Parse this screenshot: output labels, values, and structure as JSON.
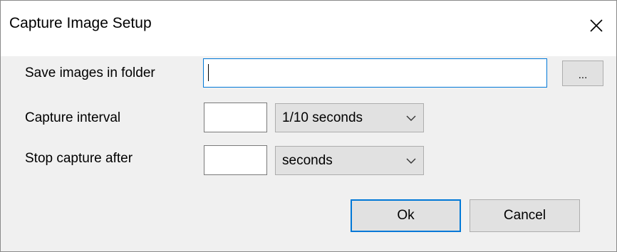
{
  "window": {
    "title": "Capture Image Setup",
    "close_icon": "close-icon"
  },
  "form": {
    "folder": {
      "label": "Save images in folder",
      "value": "",
      "browse_label": "..."
    },
    "interval": {
      "label": "Capture interval",
      "value": "",
      "unit_selected": "1/10 seconds"
    },
    "stop": {
      "label": "Stop capture after",
      "value": "",
      "unit_selected": "seconds"
    }
  },
  "buttons": {
    "ok_label": "Ok",
    "cancel_label": "Cancel"
  },
  "colors": {
    "accent": "#0078d7",
    "dialog_bg": "#f0f0f0",
    "button_bg": "#e1e1e1"
  }
}
